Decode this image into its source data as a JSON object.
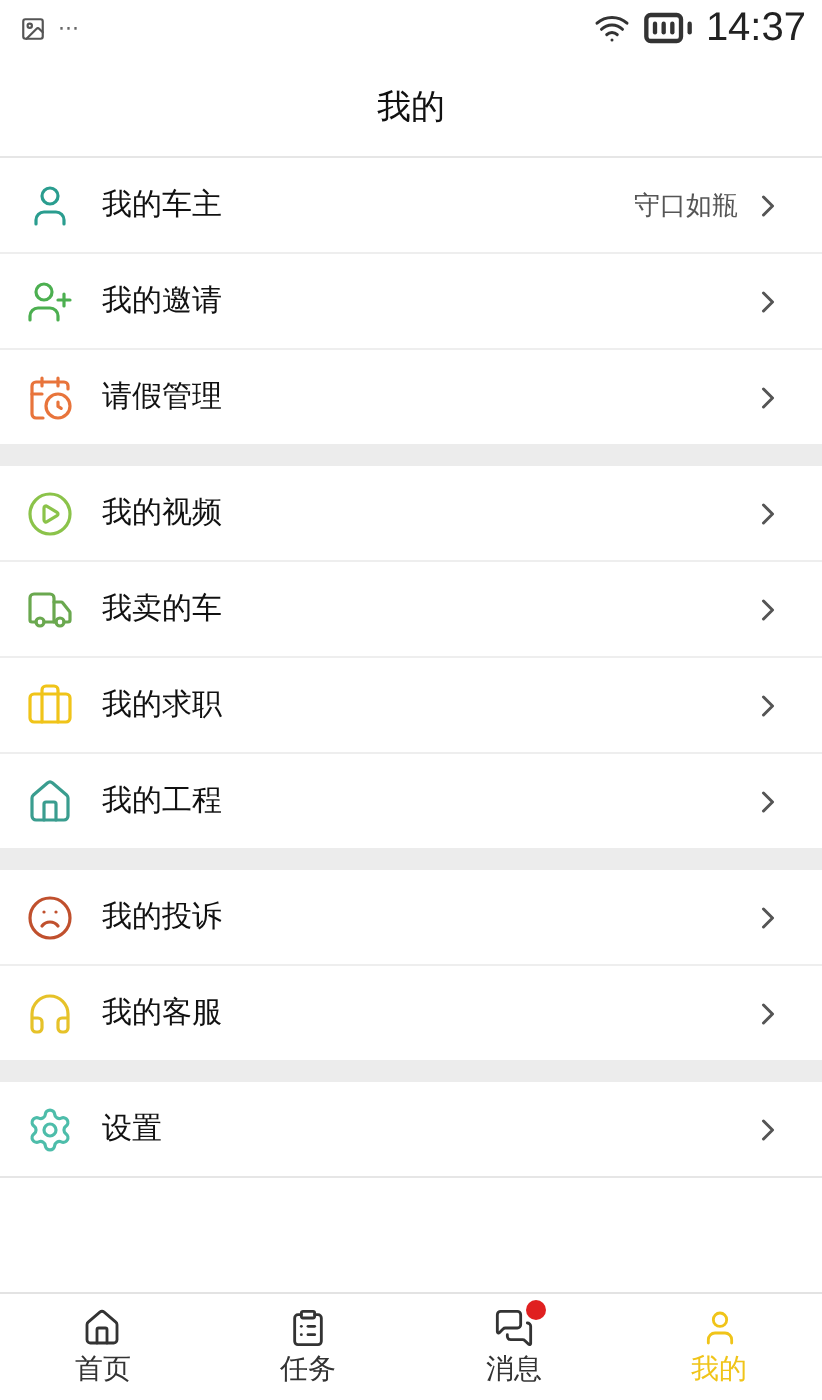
{
  "status_bar": {
    "dots": "···",
    "time": "14:37"
  },
  "title": "我的",
  "groups": [
    [
      {
        "label": "我的车主",
        "value": "守口如瓶"
      },
      {
        "label": "我的邀请"
      },
      {
        "label": "请假管理"
      }
    ],
    [
      {
        "label": "我的视频"
      },
      {
        "label": "我卖的车"
      },
      {
        "label": "我的求职"
      },
      {
        "label": "我的工程"
      }
    ],
    [
      {
        "label": "我的投诉"
      },
      {
        "label": "我的客服"
      }
    ],
    [
      {
        "label": "设置"
      }
    ]
  ],
  "tabs": [
    {
      "label": "首页",
      "selected": false,
      "badge": false
    },
    {
      "label": "任务",
      "selected": false,
      "badge": false
    },
    {
      "label": "消息",
      "selected": false,
      "badge": true
    },
    {
      "label": "我的",
      "selected": true,
      "badge": false
    }
  ]
}
